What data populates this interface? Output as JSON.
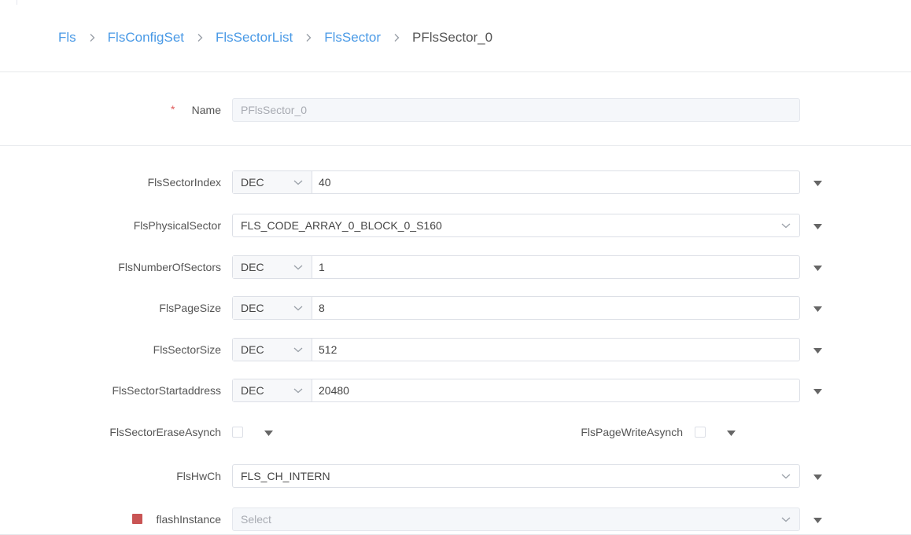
{
  "breadcrumb": {
    "items": [
      "Fls",
      "FlsConfigSet",
      "FlsSectorList",
      "FlsSector"
    ],
    "current": "PFlsSector_0"
  },
  "name_row": {
    "required_mark": "*",
    "label": "Name",
    "value": "PFlsSector_0"
  },
  "fields": {
    "sector_index": {
      "label": "FlsSectorIndex",
      "radix": "DEC",
      "value": "40"
    },
    "physical_sector": {
      "label": "FlsPhysicalSector",
      "value": "FLS_CODE_ARRAY_0_BLOCK_0_S160"
    },
    "number_of_sectors": {
      "label": "FlsNumberOfSectors",
      "radix": "DEC",
      "value": "1"
    },
    "page_size": {
      "label": "FlsPageSize",
      "radix": "DEC",
      "value": "8"
    },
    "sector_size": {
      "label": "FlsSectorSize",
      "radix": "DEC",
      "value": "512"
    },
    "sector_start_address": {
      "label": "FlsSectorStartaddress",
      "radix": "DEC",
      "value": "20480"
    },
    "sector_erase_asynch": {
      "label": "FlsSectorEraseAsynch",
      "checked": false
    },
    "page_write_asynch": {
      "label": "FlsPageWriteAsynch",
      "checked": false
    },
    "hw_ch": {
      "label": "FlsHwCh",
      "value": "FLS_CH_INTERN"
    },
    "flash_instance": {
      "label": "flashInstance",
      "placeholder": "Select"
    }
  },
  "colors": {
    "link": "#4a9ae6",
    "required": "#e05a5a",
    "reference_marker": "#c95454",
    "border": "#dcdfe6",
    "disabled_bg": "#f5f7fa"
  },
  "icons": {
    "breadcrumb_separator": "chevron-right-icon",
    "select_arrow": "chevron-down-icon",
    "expand": "caret-down-icon"
  }
}
